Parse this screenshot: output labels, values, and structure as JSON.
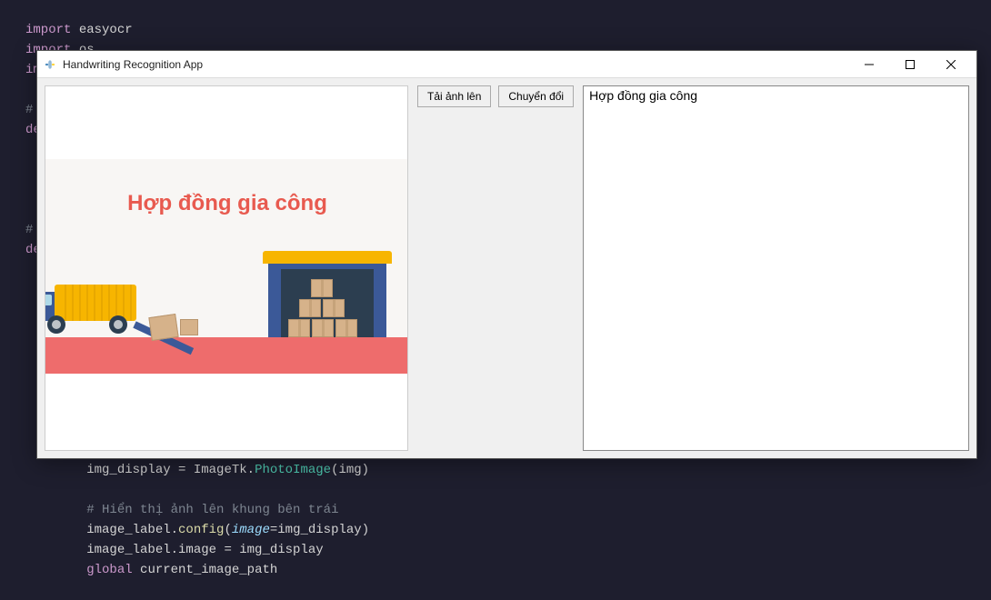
{
  "editor": {
    "lines": {
      "l0": "import easyocr",
      "l1": "import os",
      "l2": "imp",
      "l3": "",
      "l4": "# K",
      "l5": "def",
      "l6": "",
      "l7": "",
      "l8": "",
      "l9": "",
      "l10": "# H",
      "l11": "def",
      "l12": "        img_display = ImageTk.PhotoImage(img)",
      "l13": "",
      "l14": "        # Hiển thị ảnh lên khung bên trái",
      "l15": "        image_label.config(image=img_display)",
      "l16": "        image_label.image = img_display",
      "l17": "        global current_image_path"
    }
  },
  "window": {
    "title": "Handwriting Recognition App",
    "buttons": {
      "upload": "Tải ảnh lên",
      "convert": "Chuyển đổi"
    }
  },
  "illustration": {
    "title": "Hợp đồng gia công"
  },
  "result_text": "Hợp đồng gia công"
}
